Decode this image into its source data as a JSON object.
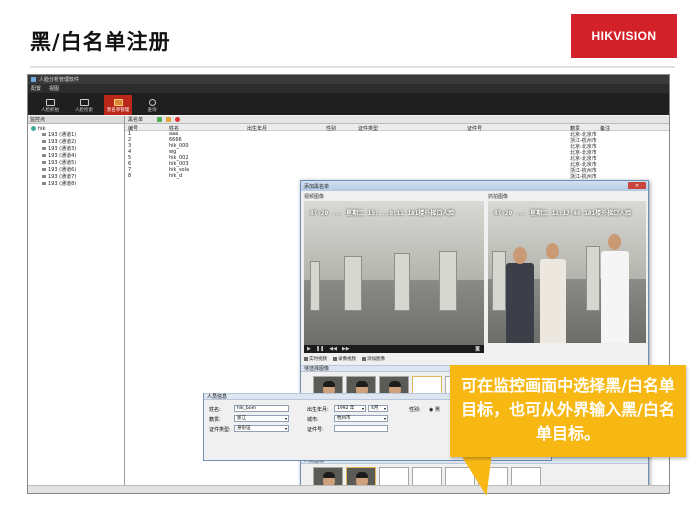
{
  "slide": {
    "title": "黑/白名单注册",
    "logo_text": "HIKVISION",
    "callout": "可在监控画面中选择黑/白名单目标，也可从外界输入黑/白名单目标。"
  },
  "app": {
    "menu": [
      "配置",
      "视图"
    ],
    "toolbar": [
      {
        "label": "人脸抓拍",
        "active": false
      },
      {
        "label": "人脸检索",
        "active": false
      },
      {
        "label": "黑名单管理",
        "active": true
      },
      {
        "label": "查询",
        "active": false
      }
    ],
    "left_panel": {
      "header": "监控点",
      "root": "hik",
      "items": [
        "193 (通道1)",
        "193 (通道2)",
        "193 (通道3)",
        "193 (通道4)",
        "193 (通道5)",
        "193 (通道6)",
        "193 (通道7)",
        "193 (通道8)"
      ]
    },
    "list": {
      "toolbar_label": "黑名单",
      "columns": [
        "编号",
        "姓名",
        "出生年月",
        "性别",
        "证件类型",
        "证件号",
        "籍贯",
        "备注"
      ],
      "rows": [
        {
          "id": "1",
          "name": "aaa",
          "native": "北京-北京市"
        },
        {
          "id": "2",
          "name": "6666",
          "native": "浙江-杭州市"
        },
        {
          "id": "3",
          "name": "hik_000",
          "native": "北京-北京市"
        },
        {
          "id": "4",
          "name": "wg",
          "native": "北京-北京市"
        },
        {
          "id": "5",
          "name": "hik_002",
          "native": "北京-北京市"
        },
        {
          "id": "6",
          "name": "hik_003",
          "native": "北京-北京市"
        },
        {
          "id": "7",
          "name": "hik_sola",
          "native": "浙江-杭州市"
        },
        {
          "id": "8",
          "name": "hik_d",
          "native": "浙江-杭州市"
        }
      ]
    }
  },
  "dialog": {
    "title": "添加黑名单",
    "close_label": "关闭",
    "video_label": "视频图像",
    "capture_label": "抓拍图像",
    "osd_left": "07-20 ... 星期二 15:...0:11   1#1楼外梯口人脸",
    "osd_right": "07-20 ... 星期二 12:17:40   1#1楼外梯口人脸",
    "video_buttons": [
      "实时视频",
      "录像视频",
      "添加图像"
    ],
    "candidates_label": "待选择图像",
    "add_label": "添加",
    "person_images_label": "人员图像",
    "person_info_label": "人员信息",
    "form": {
      "name_label": "姓名:",
      "name_value": "hik_bom",
      "birth_label": "出生年月:",
      "birth_year": "1992 年",
      "birth_month": "4月",
      "gender_label": "性别:",
      "gender_value": "男",
      "native_label": "籍贯:",
      "native_value": "浙江",
      "city_label": "城市:",
      "city_value": "杭州市",
      "idtype_label": "证件类型:",
      "idtype_value": "身份证",
      "idno_label": "证件号:"
    }
  }
}
